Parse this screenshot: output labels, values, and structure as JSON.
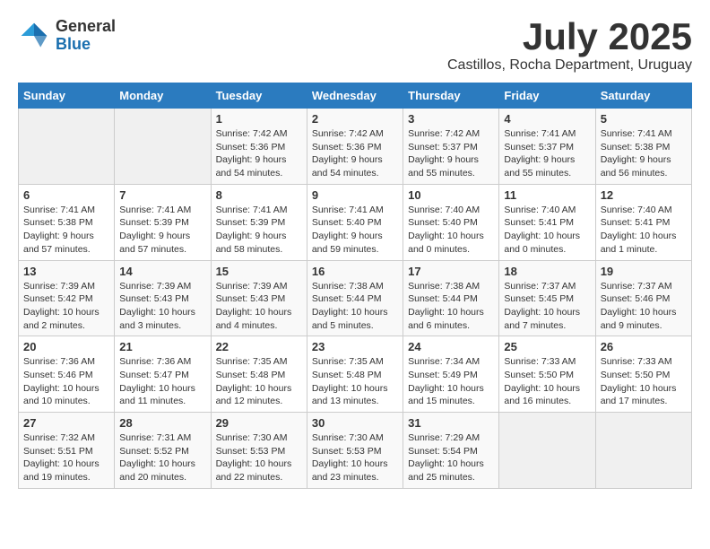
{
  "header": {
    "logo_line1": "General",
    "logo_line2": "Blue",
    "month": "July 2025",
    "location": "Castillos, Rocha Department, Uruguay"
  },
  "days_of_week": [
    "Sunday",
    "Monday",
    "Tuesday",
    "Wednesday",
    "Thursday",
    "Friday",
    "Saturday"
  ],
  "weeks": [
    [
      {
        "day": "",
        "info": ""
      },
      {
        "day": "",
        "info": ""
      },
      {
        "day": "1",
        "info": "Sunrise: 7:42 AM\nSunset: 5:36 PM\nDaylight: 9 hours and 54 minutes."
      },
      {
        "day": "2",
        "info": "Sunrise: 7:42 AM\nSunset: 5:36 PM\nDaylight: 9 hours and 54 minutes."
      },
      {
        "day": "3",
        "info": "Sunrise: 7:42 AM\nSunset: 5:37 PM\nDaylight: 9 hours and 55 minutes."
      },
      {
        "day": "4",
        "info": "Sunrise: 7:41 AM\nSunset: 5:37 PM\nDaylight: 9 hours and 55 minutes."
      },
      {
        "day": "5",
        "info": "Sunrise: 7:41 AM\nSunset: 5:38 PM\nDaylight: 9 hours and 56 minutes."
      }
    ],
    [
      {
        "day": "6",
        "info": "Sunrise: 7:41 AM\nSunset: 5:38 PM\nDaylight: 9 hours and 57 minutes."
      },
      {
        "day": "7",
        "info": "Sunrise: 7:41 AM\nSunset: 5:39 PM\nDaylight: 9 hours and 57 minutes."
      },
      {
        "day": "8",
        "info": "Sunrise: 7:41 AM\nSunset: 5:39 PM\nDaylight: 9 hours and 58 minutes."
      },
      {
        "day": "9",
        "info": "Sunrise: 7:41 AM\nSunset: 5:40 PM\nDaylight: 9 hours and 59 minutes."
      },
      {
        "day": "10",
        "info": "Sunrise: 7:40 AM\nSunset: 5:40 PM\nDaylight: 10 hours and 0 minutes."
      },
      {
        "day": "11",
        "info": "Sunrise: 7:40 AM\nSunset: 5:41 PM\nDaylight: 10 hours and 0 minutes."
      },
      {
        "day": "12",
        "info": "Sunrise: 7:40 AM\nSunset: 5:41 PM\nDaylight: 10 hours and 1 minute."
      }
    ],
    [
      {
        "day": "13",
        "info": "Sunrise: 7:39 AM\nSunset: 5:42 PM\nDaylight: 10 hours and 2 minutes."
      },
      {
        "day": "14",
        "info": "Sunrise: 7:39 AM\nSunset: 5:43 PM\nDaylight: 10 hours and 3 minutes."
      },
      {
        "day": "15",
        "info": "Sunrise: 7:39 AM\nSunset: 5:43 PM\nDaylight: 10 hours and 4 minutes."
      },
      {
        "day": "16",
        "info": "Sunrise: 7:38 AM\nSunset: 5:44 PM\nDaylight: 10 hours and 5 minutes."
      },
      {
        "day": "17",
        "info": "Sunrise: 7:38 AM\nSunset: 5:44 PM\nDaylight: 10 hours and 6 minutes."
      },
      {
        "day": "18",
        "info": "Sunrise: 7:37 AM\nSunset: 5:45 PM\nDaylight: 10 hours and 7 minutes."
      },
      {
        "day": "19",
        "info": "Sunrise: 7:37 AM\nSunset: 5:46 PM\nDaylight: 10 hours and 9 minutes."
      }
    ],
    [
      {
        "day": "20",
        "info": "Sunrise: 7:36 AM\nSunset: 5:46 PM\nDaylight: 10 hours and 10 minutes."
      },
      {
        "day": "21",
        "info": "Sunrise: 7:36 AM\nSunset: 5:47 PM\nDaylight: 10 hours and 11 minutes."
      },
      {
        "day": "22",
        "info": "Sunrise: 7:35 AM\nSunset: 5:48 PM\nDaylight: 10 hours and 12 minutes."
      },
      {
        "day": "23",
        "info": "Sunrise: 7:35 AM\nSunset: 5:48 PM\nDaylight: 10 hours and 13 minutes."
      },
      {
        "day": "24",
        "info": "Sunrise: 7:34 AM\nSunset: 5:49 PM\nDaylight: 10 hours and 15 minutes."
      },
      {
        "day": "25",
        "info": "Sunrise: 7:33 AM\nSunset: 5:50 PM\nDaylight: 10 hours and 16 minutes."
      },
      {
        "day": "26",
        "info": "Sunrise: 7:33 AM\nSunset: 5:50 PM\nDaylight: 10 hours and 17 minutes."
      }
    ],
    [
      {
        "day": "27",
        "info": "Sunrise: 7:32 AM\nSunset: 5:51 PM\nDaylight: 10 hours and 19 minutes."
      },
      {
        "day": "28",
        "info": "Sunrise: 7:31 AM\nSunset: 5:52 PM\nDaylight: 10 hours and 20 minutes."
      },
      {
        "day": "29",
        "info": "Sunrise: 7:30 AM\nSunset: 5:53 PM\nDaylight: 10 hours and 22 minutes."
      },
      {
        "day": "30",
        "info": "Sunrise: 7:30 AM\nSunset: 5:53 PM\nDaylight: 10 hours and 23 minutes."
      },
      {
        "day": "31",
        "info": "Sunrise: 7:29 AM\nSunset: 5:54 PM\nDaylight: 10 hours and 25 minutes."
      },
      {
        "day": "",
        "info": ""
      },
      {
        "day": "",
        "info": ""
      }
    ]
  ]
}
